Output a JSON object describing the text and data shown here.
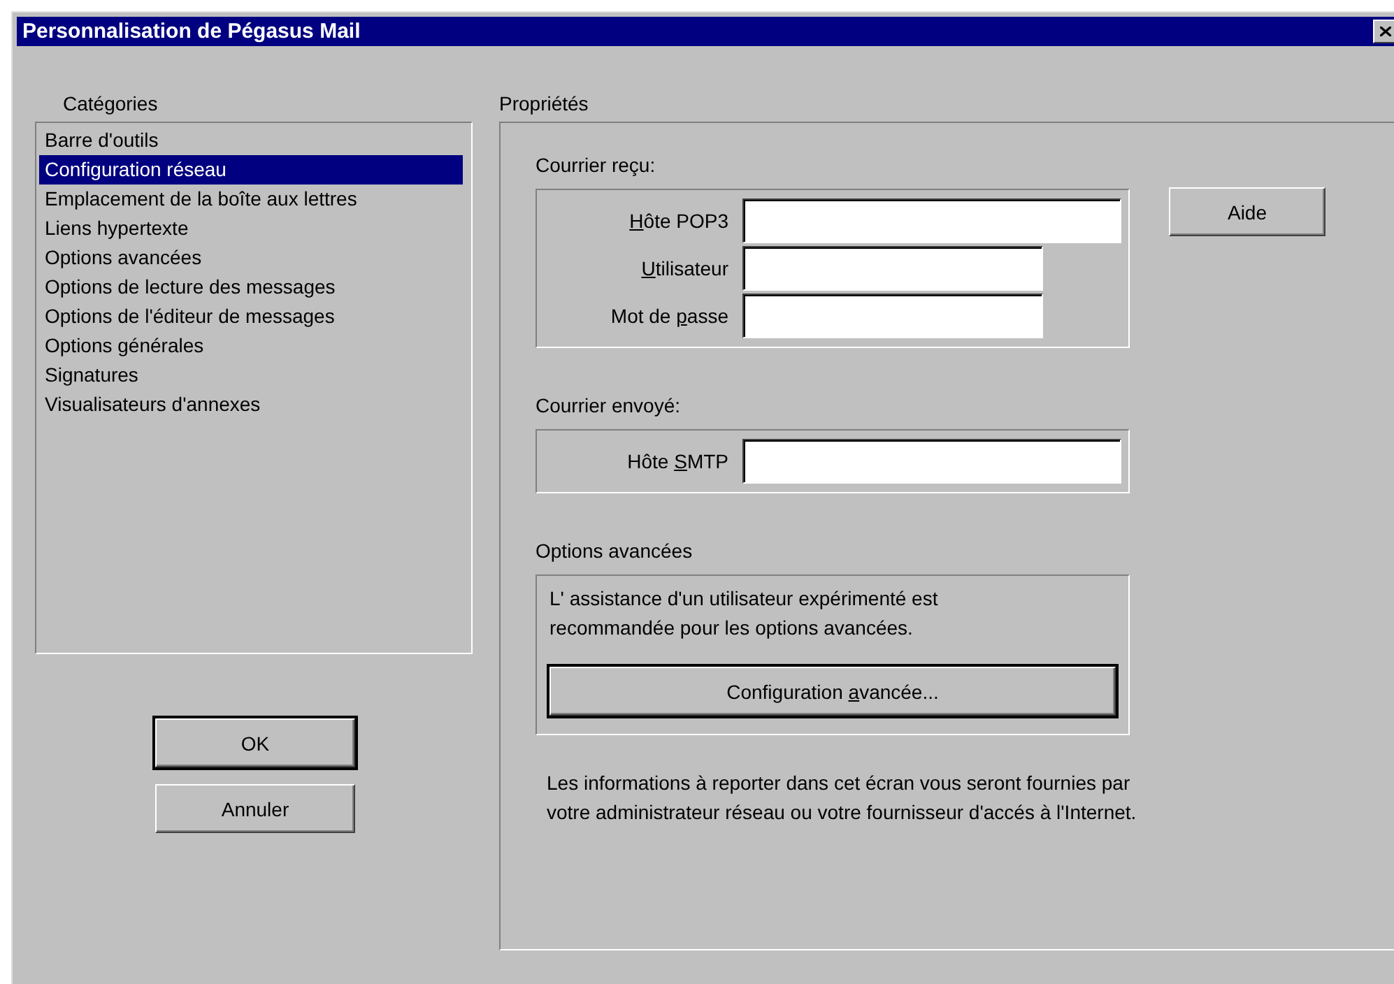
{
  "window": {
    "title": "Personnalisation de Pégasus Mail"
  },
  "categories": {
    "label": "Catégories",
    "items": [
      {
        "label": "Barre d'outils",
        "selected": false
      },
      {
        "label": "Configuration réseau",
        "selected": true
      },
      {
        "label": "Emplacement de la boîte aux lettres",
        "selected": false
      },
      {
        "label": "Liens hypertexte",
        "selected": false
      },
      {
        "label": "Options avancées",
        "selected": false
      },
      {
        "label": "Options de lecture des messages",
        "selected": false
      },
      {
        "label": "Options de l'éditeur de messages",
        "selected": false
      },
      {
        "label": "Options générales",
        "selected": false
      },
      {
        "label": "Signatures",
        "selected": false
      },
      {
        "label": "Visualisateurs d'annexes",
        "selected": false
      }
    ]
  },
  "buttons": [
    {
      "label": "OK",
      "default": true
    },
    {
      "label": "Annuler",
      "default": false
    }
  ],
  "properties": {
    "label": "Propriétés",
    "help_button": "Aide",
    "groups": [
      {
        "title": "Courrier reçu:",
        "fields": [
          {
            "label": {
              "key": "H",
              "after": "ôte POP3"
            },
            "kind": "long"
          },
          {
            "label": {
              "key": "U",
              "after": "tilisateur"
            },
            "kind": "short"
          },
          {
            "label": {
              "before": "Mot de ",
              "key": "p",
              "after": "asse"
            },
            "kind": "short"
          }
        ]
      },
      {
        "title": "Courrier envoyé:",
        "fields": [
          {
            "label": {
              "before": "Hôte ",
              "key": "S",
              "after": "MTP"
            },
            "kind": "long"
          }
        ]
      }
    ],
    "advanced": {
      "title": "Options avancées",
      "note": "L' assistance d'un utilisateur expérimenté est recommandée pour les options avancées.",
      "button": {
        "label": {
          "before": "Configuration ",
          "key": "a",
          "after": "vancée..."
        },
        "default": true
      }
    },
    "info": "Les informations à reporter dans cet écran vous seront fournies par votre administrateur réseau ou votre fournisseur d'accés à l'Internet."
  }
}
